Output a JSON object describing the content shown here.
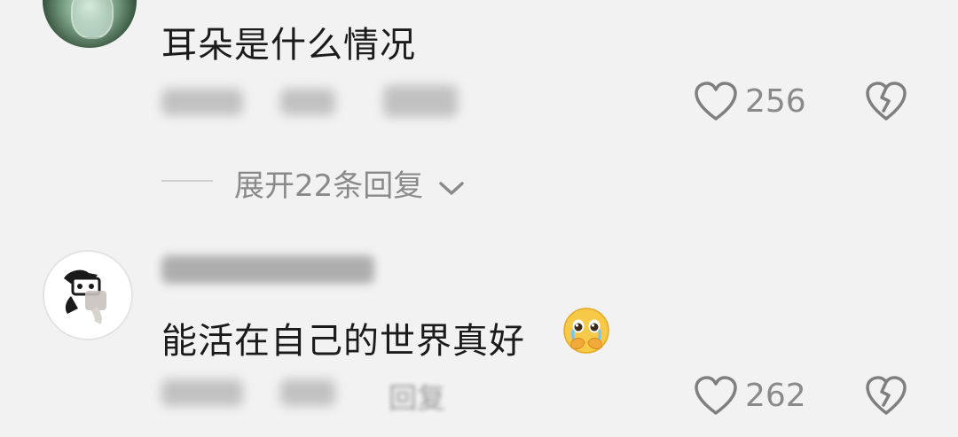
{
  "comments": [
    {
      "text": "耳朵是什么情况",
      "like_count": "256",
      "expand_replies": "展开22条回复"
    },
    {
      "text": "能活在自己的世界真好",
      "emoji": "pleading-face-emoji",
      "like_count": "262",
      "reply_label": "回复"
    }
  ],
  "icons": {
    "like": "heart-outline-icon",
    "dislike": "broken-heart-icon",
    "expand": "chevron-down-icon"
  },
  "colors": {
    "background": "#f2f2f2",
    "text_primary": "#1b1b1b",
    "text_secondary": "#8a8a8a"
  }
}
